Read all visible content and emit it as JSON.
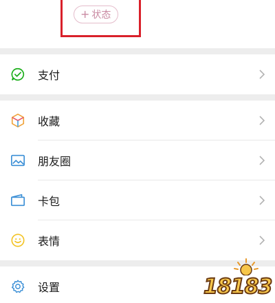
{
  "status": {
    "plus": "+",
    "label": "状态"
  },
  "menu": {
    "pay": {
      "label": "支付",
      "icon": "wallet-check-icon",
      "color": "#1aad19"
    },
    "favorites": {
      "label": "收藏",
      "icon": "cube-icon"
    },
    "moments": {
      "label": "朋友圈",
      "icon": "picture-icon",
      "color": "#3b8fd6"
    },
    "cards": {
      "label": "卡包",
      "icon": "card-wallet-icon",
      "color": "#3b8fd6"
    },
    "stickers": {
      "label": "表情",
      "icon": "smiley-icon",
      "color": "#f3c324"
    },
    "settings": {
      "label": "设置",
      "icon": "gear-icon",
      "color": "#3b8fd6"
    }
  },
  "watermark": {
    "text": "18183"
  }
}
